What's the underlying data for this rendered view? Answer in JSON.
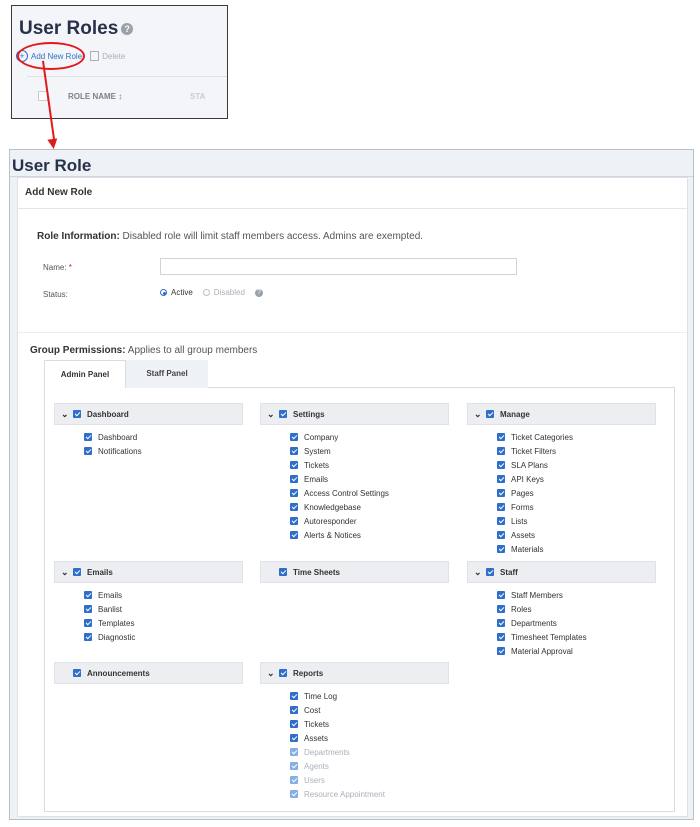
{
  "inset": {
    "title": "User Roles",
    "help_glyph": "?",
    "add_label": "Add New Role",
    "delete_label": "Delete",
    "col_role_name": "ROLE NAME ↕",
    "col_status": "STA"
  },
  "main": {
    "title": "User Role",
    "card_title": "Add New Role",
    "role_info_label": "Role Information:",
    "role_info_text": " Disabled role will limit staff members access. Admins are exempted.",
    "name_label": "Name:",
    "name_required": "*",
    "name_value": "",
    "status_label": "Status:",
    "status_options": [
      "Active",
      "Disabled"
    ],
    "status_selected": "Active",
    "group_perm_label": "Group Permissions:",
    "group_perm_text": " Applies to all group members",
    "tabs": [
      "Admin Panel",
      "Staff Panel"
    ]
  },
  "groups": [
    {
      "title": "Dashboard",
      "expandable": true,
      "items": [
        "Dashboard",
        "Notifications"
      ]
    },
    {
      "title": "Settings",
      "expandable": true,
      "items": [
        "Company",
        "System",
        "Tickets",
        "Emails",
        "Access Control Settings",
        "Knowledgebase",
        "Autoresponder",
        "Alerts & Notices"
      ]
    },
    {
      "title": "Manage",
      "expandable": true,
      "items": [
        "Ticket Categories",
        "Ticket Filters",
        "SLA Plans",
        "API Keys",
        "Pages",
        "Forms",
        "Lists",
        "Assets",
        "Materials"
      ]
    },
    {
      "title": "Emails",
      "expandable": true,
      "items": [
        "Emails",
        "Banlist",
        "Templates",
        "Diagnostic"
      ]
    },
    {
      "title": "Time Sheets",
      "expandable": false,
      "items": []
    },
    {
      "title": "Staff",
      "expandable": true,
      "items": [
        "Staff Members",
        "Roles",
        "Departments",
        "Timesheet Templates",
        "Material Approval"
      ]
    },
    {
      "title": "Announcements",
      "expandable": false,
      "items": []
    },
    {
      "title": "Reports",
      "expandable": true,
      "items": [
        "Time Log",
        "Cost",
        "Tickets",
        "Assets",
        "Departments",
        "Agents",
        "Users",
        "Resource Appointment"
      ],
      "faded_from": 4
    }
  ]
}
